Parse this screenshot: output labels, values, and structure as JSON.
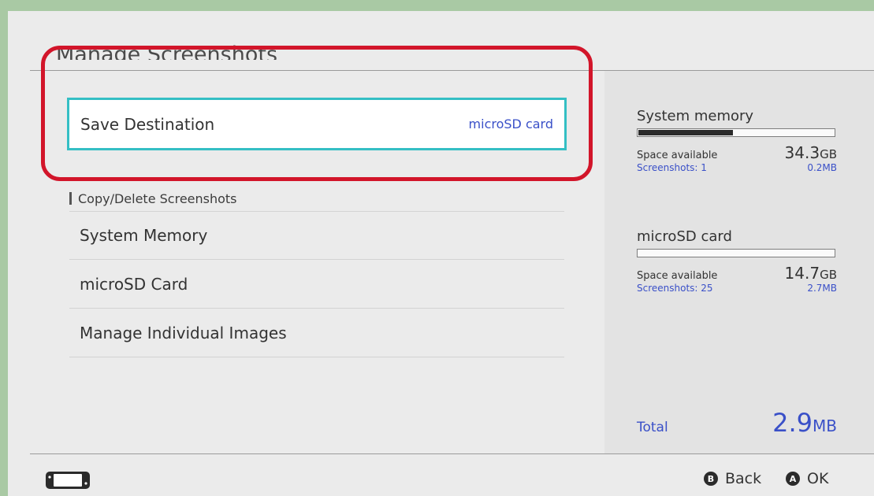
{
  "header": {
    "title": "Manage Screenshots"
  },
  "save_destination": {
    "label": "Save Destination",
    "value": "microSD card"
  },
  "copy_delete": {
    "heading": "Copy/Delete Screenshots",
    "items": [
      {
        "label": "System Memory"
      },
      {
        "label": "microSD Card"
      },
      {
        "label": "Manage Individual Images"
      }
    ]
  },
  "storage": {
    "system_memory": {
      "name": "System memory",
      "usage_fraction": 0.48,
      "space_label": "Space available",
      "space_value": "34.3",
      "space_unit": "GB",
      "screenshots_label": "Screenshots: 1",
      "screenshots_size": "0.2MB"
    },
    "microsd": {
      "name": "microSD card",
      "usage_fraction": 0.0,
      "space_label": "Space available",
      "space_value": "14.7",
      "space_unit": "GB",
      "screenshots_label": "Screenshots: 25",
      "screenshots_size": "2.7MB"
    },
    "total": {
      "label": "Total",
      "value": "2.9",
      "unit": "MB"
    }
  },
  "footer": {
    "back": {
      "glyph": "B",
      "label": "Back"
    },
    "ok": {
      "glyph": "A",
      "label": "OK"
    }
  },
  "colors": {
    "accent_blue": "#3a50c8",
    "selection_teal": "#34bfc4",
    "highlight_red": "#d2152a",
    "background_green": "#a9c9a4"
  },
  "icons": {
    "console": "console-handheld-icon"
  }
}
